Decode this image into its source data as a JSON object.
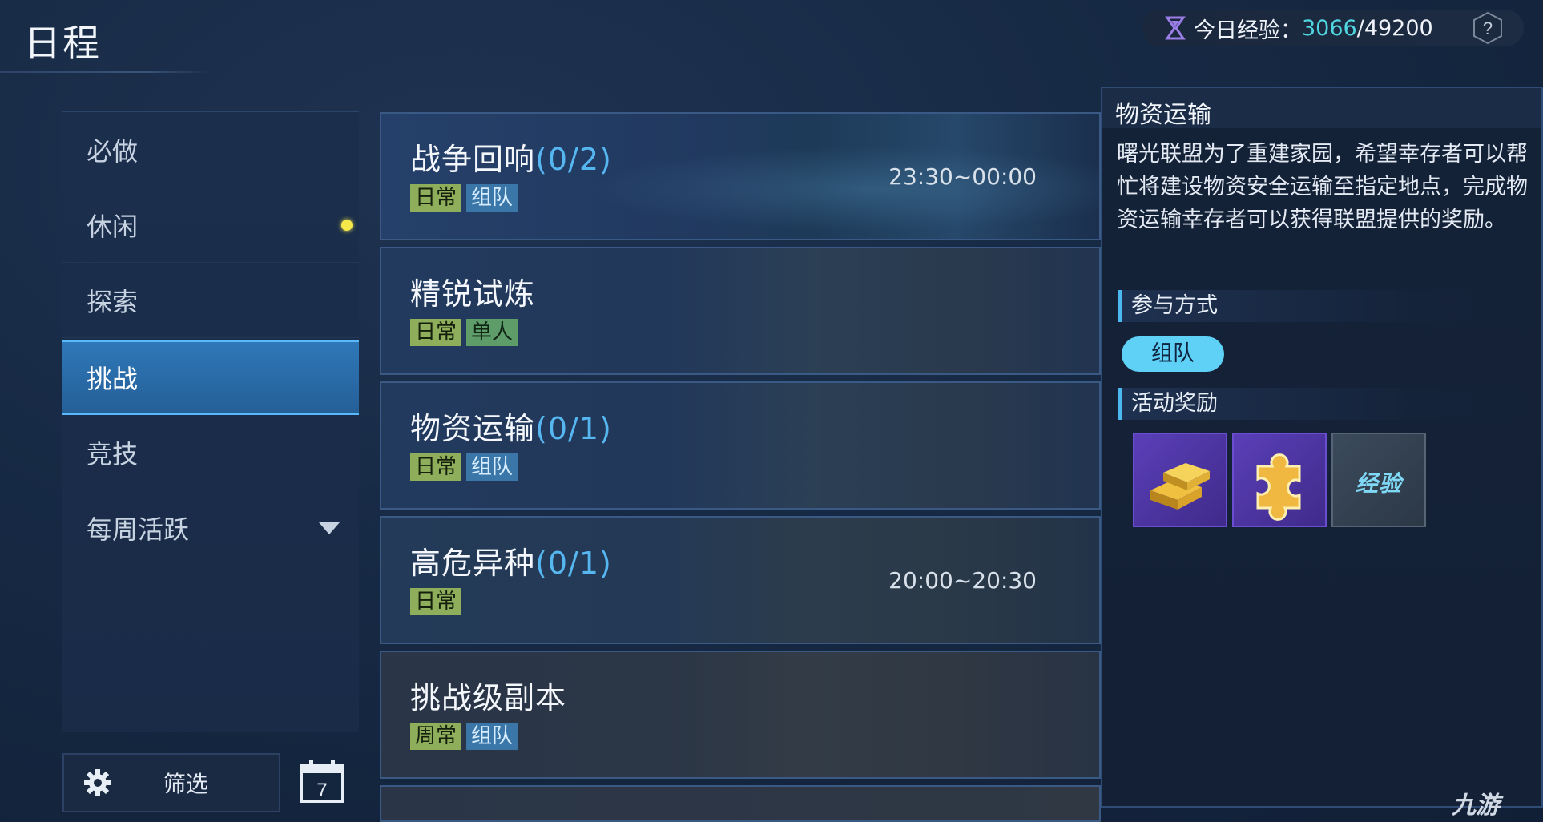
{
  "header": {
    "title": "日程",
    "exp_label": "今日经验：",
    "exp_current": "3066",
    "exp_total": "/49200",
    "help_icon": "question-icon"
  },
  "sidebar": {
    "items": [
      {
        "label": "必做"
      },
      {
        "label": "休闲",
        "badge": "notification-dot"
      },
      {
        "label": "探索"
      },
      {
        "label": "挑战",
        "active": true
      },
      {
        "label": "竞技"
      },
      {
        "label": "每周活跃",
        "expand_icon": "triangle-down-icon"
      }
    ],
    "filter_label": "筛选",
    "calendar_day": "7"
  },
  "activities": [
    {
      "name": "战争回响",
      "count": "(0/2)",
      "tags": [
        "日常",
        "组队"
      ],
      "time": "23:30~00:00"
    },
    {
      "name": "精锐试炼",
      "count": "",
      "tags": [
        "日常",
        "单人"
      ],
      "time": ""
    },
    {
      "name": "物资运输",
      "count": "(0/1)",
      "tags": [
        "日常",
        "组队"
      ],
      "time": ""
    },
    {
      "name": "高危异种",
      "count": "(0/1)",
      "tags": [
        "日常"
      ],
      "time": "20:00~20:30"
    },
    {
      "name": "挑战级副本",
      "count": "",
      "tags": [
        "周常",
        "组队"
      ],
      "time": ""
    }
  ],
  "detail": {
    "title": "物资运输",
    "description": "曙光联盟为了重建家园，希望幸存者可以帮忙将建设物资安全运输至指定地点，完成物资运输幸存者可以获得联盟提供的奖励。",
    "participation_label": "参与方式",
    "participation_mode": "组队",
    "reward_label": "活动奖励",
    "rewards": [
      {
        "icon": "gold-bars-icon"
      },
      {
        "icon": "gold-puzzle-piece-icon"
      },
      {
        "icon": "exp-icon",
        "text": "经验"
      }
    ]
  },
  "watermark": "九游",
  "colors": {
    "accent": "#4fd6e0",
    "tag_daily": "#8fae5c",
    "tag_team": "#3a76a8",
    "tag_solo": "#5e9c6a",
    "active_nav": "#2e78b8",
    "pill": "#5fd0f6"
  }
}
